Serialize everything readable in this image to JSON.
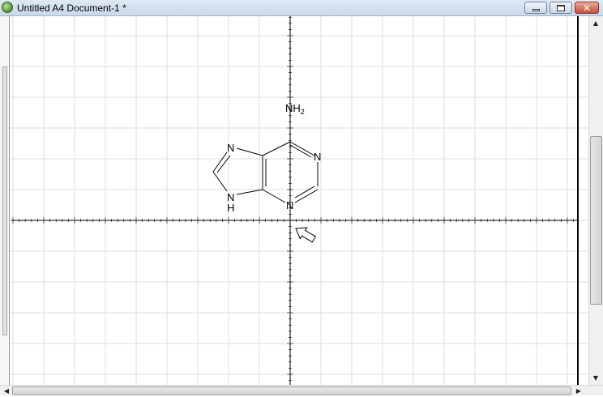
{
  "window": {
    "title": "Untitled A4 Document-1 *",
    "controls": {
      "minimize": "minimize",
      "maximize": "maximize",
      "close": "✕"
    }
  },
  "molecule": {
    "labels": {
      "amine": "NH",
      "amine_sub": "2",
      "n1": "N",
      "n3": "N",
      "n7": "N",
      "n9": "N",
      "n9_h": "H"
    }
  },
  "colors": {
    "grid": "#dcdcdc",
    "axis": "#000000"
  },
  "icons": [
    "app-icon",
    "minimize-icon",
    "maximize-icon",
    "close-icon",
    "scroll-up-icon",
    "scroll-down-icon",
    "scroll-left-icon",
    "scroll-right-icon",
    "arrow-pointer-icon"
  ]
}
